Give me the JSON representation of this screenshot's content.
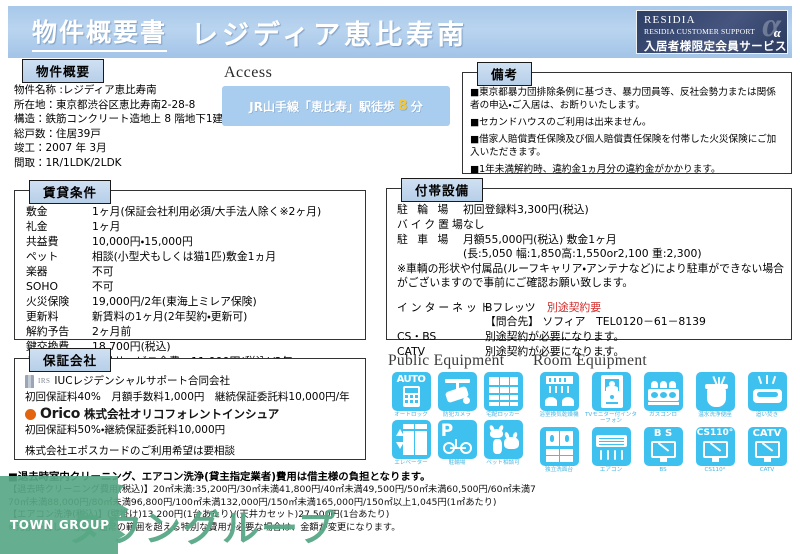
{
  "header": {
    "title": "物件概要書",
    "property_name": "レジディア恵比寿南",
    "logo": {
      "line1": "RESIDIA",
      "line2": "RESIDIA CUSTOMER SUPPORT",
      "alpha": "α",
      "line3": "入居者様限定会員サービス"
    }
  },
  "overview": {
    "tab": "物件概要",
    "lines": [
      "物件名称 :レジディア恵比寿南",
      "所在地：東京都渋谷区恵比寿南2-28-8",
      "構造：鉄筋コンクリート造地上 8 階地下1建",
      "総戸数：住居39戸",
      "竣工：2007 年 3月",
      "間取：1R/1LDK/2LDK"
    ]
  },
  "access": {
    "title": "Access",
    "prefix": "JR山手線「恵比寿」駅徒歩",
    "minutes": "8",
    "suffix": "分"
  },
  "remarks": {
    "tab": "備考",
    "items": [
      "■東京都暴力団排除条例に基づき、暴力団員等、反社会勢力または関係者の申込・ご入居は、お断りいたします。",
      "■セカンドハウスのご利用は出来ません。",
      "■借家人賠償責任保険及び個人賠償責任保険を付帯した火災保険にご加入いただきます。",
      "■1年未満解約時、違約金1ヵ月分の違約金がかかります。"
    ]
  },
  "rent": {
    "tab": "賃貸条件",
    "rows": [
      {
        "key": "敷金",
        "value": "1ヶ月(保証会社利用必須/大手法人除く※2ヶ月)"
      },
      {
        "key": "礼金",
        "value": "1ヶ月"
      },
      {
        "key": "共益費",
        "value": "10,000円・15,000円"
      },
      {
        "key": "ペット",
        "value": "相談(小型犬もしくは猫1匹)敷金1ヵ月"
      },
      {
        "key": "楽器",
        "value": "不可"
      },
      {
        "key": "SOHO",
        "value": "不可"
      },
      {
        "key": "火災保険",
        "value": "19,000円/2年(東海上ミレア保険)"
      },
      {
        "key": "更新料",
        "value": "新賃料の1ヶ月(2年契約・更新可)"
      },
      {
        "key": "解約予告",
        "value": "2ヶ月前"
      },
      {
        "key": "鍵交換費",
        "value": "18,700円(税込)"
      }
    ],
    "member_fee": "入居者様限定会員サービス会費　11,000円(税込)/2年"
  },
  "facilities": {
    "tab": "付帯設備",
    "rows": [
      {
        "key": "駐 輪 場",
        "value": "初回登録料3,300円(税込)"
      },
      {
        "key": "バイク置場",
        "value": "なし"
      },
      {
        "key": "駐 車 場",
        "value": "月額55,000円(税込) 敷金1ヶ月"
      }
    ],
    "parking_size": "(長:5,050 幅:1,850高:1,550or2,100 重:2,300)",
    "parking_note1": "※車輌の形状や付属品(ルーフキャリア・アンテナなど)により駐車ができない場合",
    "parking_note2": "がございますので事前にご確認お願い致します。",
    "internet_key": "インターネット",
    "internet_value": "Bフレッツ",
    "internet_flag": "別途契約要",
    "internet_contact": "【問合先】 ソフィア　TEL0120－61－8139",
    "csbs_key": "CS・BS",
    "csbs_value": "別途契約が必要になります。",
    "catv_key": "CATV",
    "catv_value": "別途契約が必要になります。"
  },
  "guarantee": {
    "tab": "保証会社",
    "iuc_name": "IUCレジデンシャルサポート合同会社",
    "iuc_mark_text": "IRS",
    "iuc_terms": "初回保証料40%　月額手数料1,000円　継続保証委託料10,000円/年",
    "orico_brand": "Orico",
    "orico_name": "株式会社オリコフォレントインシュア",
    "orico_terms": "初回保証料50%・継続保証委託料10,000円",
    "epos_note": "株式会社エポスカードのご利用希望は要相談"
  },
  "public_equipment": {
    "title": "Public Equipment",
    "items": [
      {
        "icon": "auto-lock-icon",
        "label": "オートロック"
      },
      {
        "icon": "security-camera-icon",
        "label": "防犯カメラ"
      },
      {
        "icon": "delivery-locker-icon",
        "label": "宅配ロッカー"
      },
      {
        "icon": "elevator-icon",
        "label": "エレベーター"
      },
      {
        "icon": "bicycle-parking-icon",
        "label": "駐輪場"
      },
      {
        "icon": "pet-allowed-icon",
        "label": "ペット相談可"
      }
    ]
  },
  "room_equipment": {
    "title": "Room Equipment",
    "items": [
      {
        "icon": "bath-dryer-icon",
        "label": "浴室換気乾燥機"
      },
      {
        "icon": "tv-intercom-icon",
        "label": "TVモニター付インターフォン"
      },
      {
        "icon": "gas-stove-icon",
        "label": "ガスコンロ"
      },
      {
        "icon": "washlet-icon",
        "label": "温水洗浄便座"
      },
      {
        "icon": "reheating-bath-icon",
        "label": "追い焚き"
      },
      {
        "icon": "separate-washstand-icon",
        "label": "独立洗面台"
      },
      {
        "icon": "air-conditioner-icon",
        "label": "エアコン"
      },
      {
        "icon": "bs-icon",
        "label": "BS",
        "badge": "B S"
      },
      {
        "icon": "cs110-icon",
        "label": "CS110°",
        "badge": "CS110°"
      },
      {
        "icon": "catv-icon",
        "label": "CATV",
        "badge": "CATV"
      }
    ]
  },
  "footnotes": {
    "main": "■退去時室内クリーニング、エアコン洗浄(貸主指定業者)費用は借主様の負担となります。",
    "line1": "【退去時クリーニング費用(税込)】20㎡未満:35,200円/30㎡未満41,800円/40㎡未満49,500円/50㎡未満60,500円/60㎡未満7",
    "line2": "70㎡未満88,000円/80㎡未満96,800円/100㎡未満132,000円/150㎡未満165,000円/150㎡以上1,045円(1㎡あたり)",
    "line3": "【エアコン洗浄(税込)】(壁掛け)13,200円(1台あたり)/(天井カセット)27,500円(1台あたり)",
    "line4": "※汚損が著しい場合、通常の範囲を超える特別な費用が必要な場合は、金額が変更になります。"
  },
  "watermark": {
    "jp": "タウングループ",
    "en": "TOWN GROUP"
  },
  "colors": {
    "header_blue": "#a8c8ea",
    "tab_blue": "#b7cfe9",
    "icon_cyan": "#3fc1ef",
    "accent_red": "#d32a2a",
    "watermark_green": "#58a886"
  }
}
